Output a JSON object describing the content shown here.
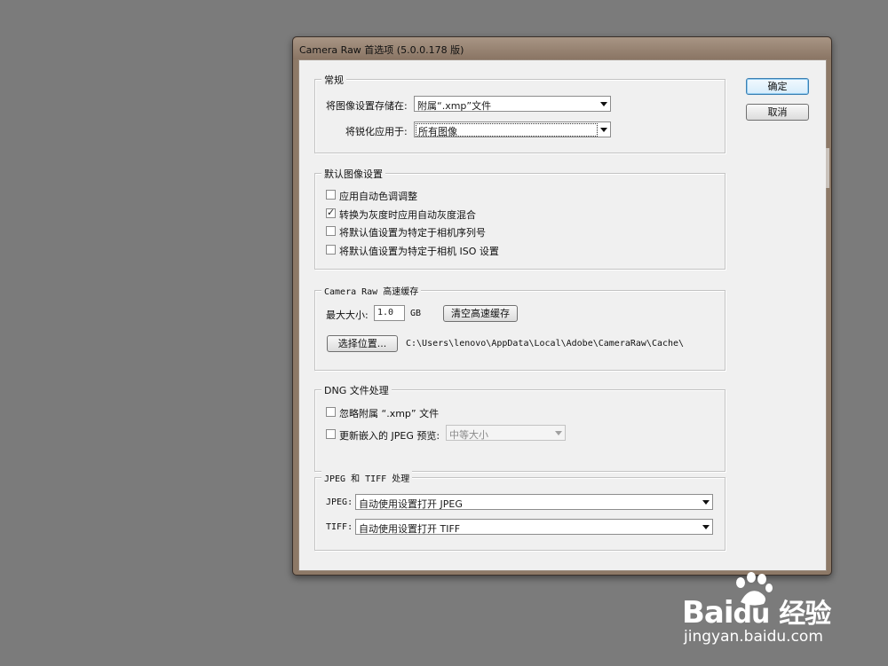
{
  "dialog": {
    "title": "Camera Raw 首选项 (5.0.0.178 版)",
    "ok_label": "确定",
    "cancel_label": "取消"
  },
  "general": {
    "title": "常规",
    "save_settings_label": "将图像设置存储在:",
    "save_settings_value": "附属“.xmp”文件",
    "apply_sharpen_label": "将锐化应用于:",
    "apply_sharpen_value": "所有图像"
  },
  "default_settings": {
    "title": "默认图像设置",
    "options": [
      {
        "label": "应用自动色调调整",
        "checked": false
      },
      {
        "label": "转换为灰度时应用自动灰度混合",
        "checked": true
      },
      {
        "label": "将默认值设置为特定于相机序列号",
        "checked": false
      },
      {
        "label": "将默认值设置为特定于相机 ISO 设置",
        "checked": false
      }
    ]
  },
  "cache": {
    "title": "Camera Raw 高速缓存",
    "max_size_label": "最大大小:",
    "max_size_value": "1.0",
    "unit": "GB",
    "purge_label": "清空高速缓存",
    "select_location_label": "选择位置...",
    "location_path": "C:\\Users\\lenovo\\AppData\\Local\\Adobe\\CameraRaw\\Cache\\"
  },
  "dng": {
    "title": "DNG 文件处理",
    "ignore_sidecar_label": "忽略附属 “.xmp” 文件",
    "ignore_sidecar_checked": false,
    "update_preview_label": "更新嵌入的 JPEG 预览:",
    "update_preview_checked": false,
    "preview_size_value": "中等大小"
  },
  "jpeg_tiff": {
    "title": "JPEG 和 TIFF 处理",
    "jpeg_label": "JPEG:",
    "jpeg_value": "自动使用设置打开 JPEG",
    "tiff_label": "TIFF:",
    "tiff_value": "自动使用设置打开 TIFF"
  },
  "watermark": {
    "brand": "Bai",
    "brand_cn": "经验",
    "url": "jingyan.baidu.com"
  }
}
